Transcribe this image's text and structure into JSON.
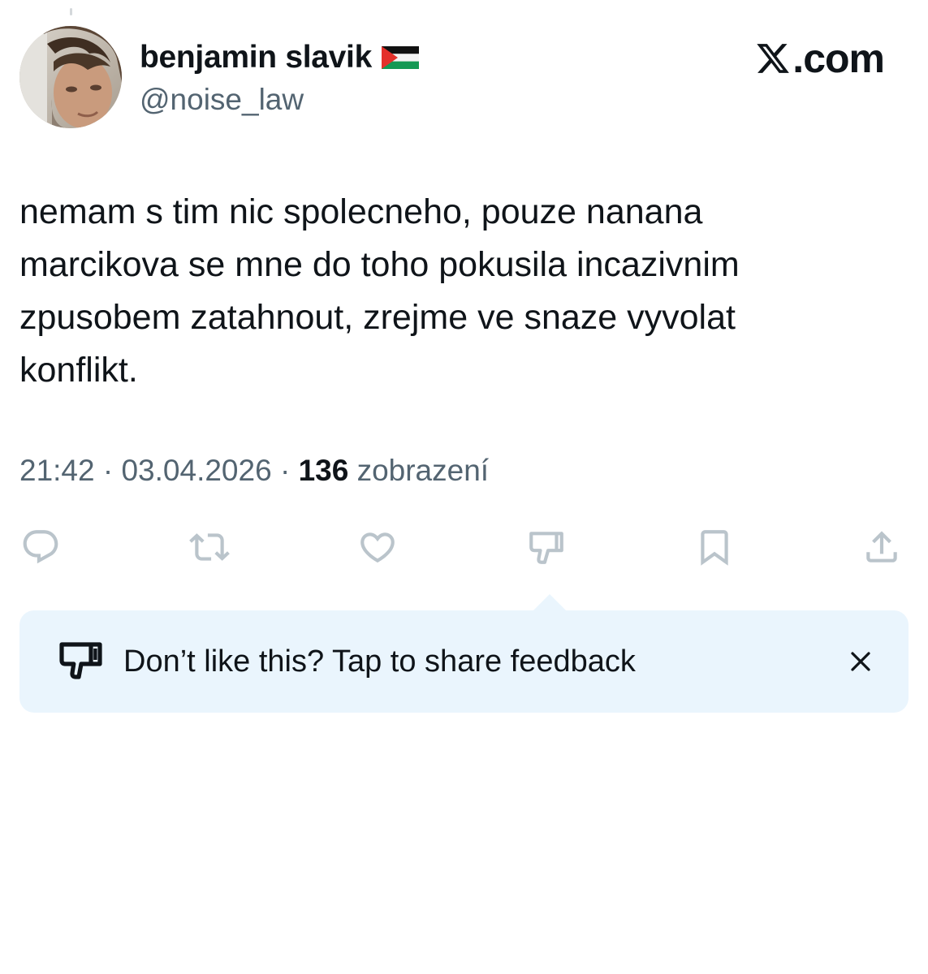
{
  "author": {
    "display_name": "benjamin slavik",
    "handle": "@noise_law",
    "flag_icon": "palestine-flag-icon",
    "avatar": "profile-photo"
  },
  "site": {
    "logo_icon": "x-logo-icon",
    "logo_text": ".com"
  },
  "tweet": {
    "text": "nemam s tim nic spolecneho, pouze nanana marcikova se mne do toho pokusila incazivnim zpusobem zatahnout, zrejme ve snaze vyvolat konflikt.",
    "time": "21:42",
    "separator": "·",
    "date": "03.04.2026",
    "views_count": "136",
    "views_label": "zobrazení"
  },
  "actions": [
    {
      "name": "reply",
      "icon": "reply-icon"
    },
    {
      "name": "retweet",
      "icon": "retweet-icon"
    },
    {
      "name": "like",
      "icon": "heart-icon"
    },
    {
      "name": "dislike",
      "icon": "thumbs-down-icon"
    },
    {
      "name": "bookmark",
      "icon": "bookmark-icon"
    },
    {
      "name": "share",
      "icon": "share-icon"
    }
  ],
  "feedback": {
    "icon": "thumbs-down-icon",
    "text": "Don’t like this? Tap to share feedback",
    "close_icon": "close-icon"
  },
  "colors": {
    "text_primary": "#0f1419",
    "text_secondary": "#536471",
    "icon_muted": "#bac4cb",
    "feedback_background": "#eaf5fd"
  }
}
